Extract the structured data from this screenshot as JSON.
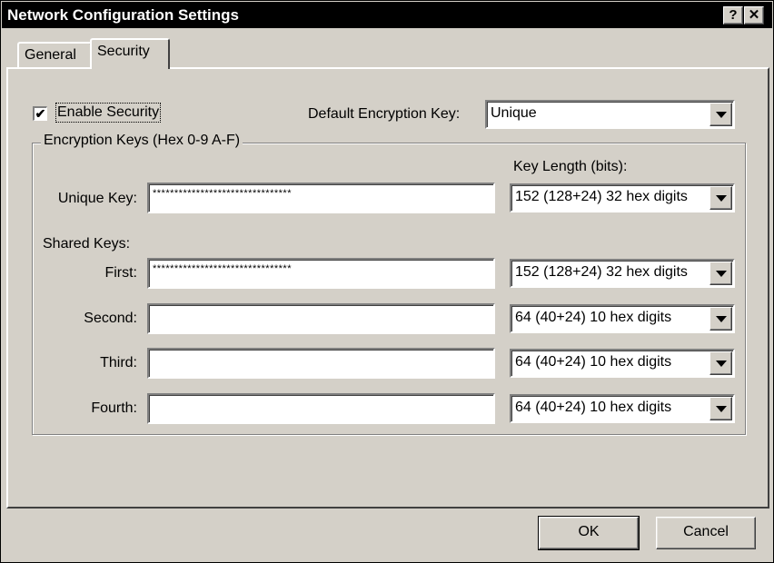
{
  "window": {
    "title": "Network Configuration Settings",
    "help_button": "?",
    "close_button": "✕"
  },
  "tabs": [
    {
      "label": "General",
      "active": false
    },
    {
      "label": "Security",
      "active": true
    }
  ],
  "security": {
    "enable_security_label": "Enable Security",
    "enable_security_checked": true,
    "checkmark": "✔",
    "default_key_label": "Default Encryption Key:",
    "default_key_value": "Unique"
  },
  "encryption": {
    "group_title": "Encryption Keys (Hex 0-9 A-F)",
    "key_length_header": "Key Length (bits):",
    "unique_key": {
      "label": "Unique Key:",
      "value": "********************************",
      "length": "152 (128+24) 32 hex digits"
    },
    "shared_keys_label": "Shared Keys:",
    "shared_keys": [
      {
        "label": "First:",
        "value": "********************************",
        "length": "152 (128+24) 32 hex digits"
      },
      {
        "label": "Second:",
        "value": "",
        "length": "64  (40+24)  10 hex digits"
      },
      {
        "label": "Third:",
        "value": "",
        "length": "64  (40+24)  10 hex digits"
      },
      {
        "label": "Fourth:",
        "value": "",
        "length": "64  (40+24)  10 hex digits"
      }
    ]
  },
  "buttons": {
    "ok": "OK",
    "cancel": "Cancel"
  }
}
